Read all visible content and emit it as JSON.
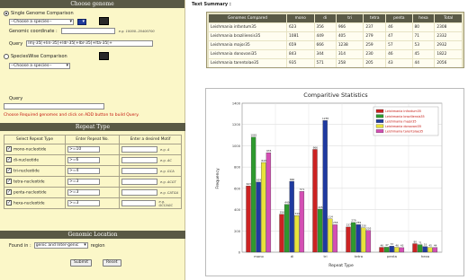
{
  "left": {
    "choose_genome": {
      "header": "Choose genome",
      "single_label": "Single Genome Comparison",
      "species_placeholder": "--Choose a species--",
      "coordinate_label": "Genomic coordinate :",
      "coordinate_hint": "e.g. 10000..20400700",
      "query_label": "Query",
      "query_value": "lmj-35[+lin-35[+ldr-35[+lbr-35[+lta-35[+",
      "specieswise_label": "SpeciesWise Comparison",
      "specieswise_placeholder": "--Choose a species--",
      "query2_label": "Query",
      "notice": "Choose Required genomes and click on ADD button to build Query."
    },
    "repeat_type": {
      "header": "Repeat Type",
      "columns": [
        "Select Repeat Type",
        "Enter Repeat No.",
        "Enter a desired Motif"
      ],
      "rows": [
        {
          "name": "mono-nucleotide",
          "number": ">=10",
          "hint": "e.g. A"
        },
        {
          "name": "di-nucleotide",
          "number": ">=6",
          "hint": "e.g. AC"
        },
        {
          "name": "tri-nucleotide",
          "number": ">=4",
          "hint": "e.g. GCA"
        },
        {
          "name": "tetra-nucleotide",
          "number": ">=3",
          "hint": "e.g. ACGT"
        },
        {
          "name": "penta-nucleotide",
          "number": ">=3",
          "hint": "e.g. CATGA"
        },
        {
          "name": "hexa-nucleotide",
          "number": ">=3",
          "hint": "e.g. GCCAGC"
        }
      ]
    },
    "genomic_location": {
      "header": "Genomic Location",
      "found_in_label": "Found in :",
      "found_in_value": "genic and Inter-genic",
      "region_label": "region",
      "submit": "Submit",
      "reset": "Reset"
    }
  },
  "summary": {
    "title": "Text Summary :",
    "columns": [
      "Genomes Compared",
      "mono",
      "di",
      "tri",
      "tetra",
      "penta",
      "hexa",
      "Total"
    ],
    "rows": [
      [
        "Leishmania infantum35",
        "623",
        "356",
        "966",
        "237",
        "46",
        "80",
        "2308"
      ],
      [
        "Leishmania braziliensis35",
        "1081",
        "449",
        "405",
        "279",
        "47",
        "71",
        "2332"
      ],
      [
        "Leishmania major35",
        "659",
        "666",
        "1238",
        "259",
        "57",
        "53",
        "2932"
      ],
      [
        "Leishmania donovani35",
        "843",
        "344",
        "314",
        "230",
        "46",
        "45",
        "1822"
      ],
      [
        "Leishmania tarentolae35",
        "935",
        "571",
        "258",
        "205",
        "43",
        "44",
        "2056"
      ]
    ]
  },
  "chart_data": {
    "type": "bar",
    "title": "Comparitive Statistics",
    "xlabel": "Repeat Type",
    "ylabel": "Frequency",
    "categories": [
      "mono",
      "di",
      "tri",
      "tetra",
      "penta",
      "hexa"
    ],
    "ylim": [
      0,
      1400
    ],
    "grid": true,
    "legend": "top-right",
    "series": [
      {
        "name": "Leishmania infantum35",
        "color": "#cc2222",
        "values": [
          623,
          356,
          966,
          237,
          46,
          80
        ]
      },
      {
        "name": "Leishmania braziliensis35",
        "color": "#2e9a2e",
        "values": [
          1081,
          449,
          405,
          279,
          47,
          71
        ]
      },
      {
        "name": "Leishmania major35",
        "color": "#1f3aa0",
        "values": [
          659,
          666,
          1238,
          259,
          57,
          53
        ]
      },
      {
        "name": "Leishmania donovani35",
        "color": "#e8e23a",
        "values": [
          843,
          344,
          314,
          230,
          46,
          45
        ]
      },
      {
        "name": "Leishmania tarentolae35",
        "color": "#d44fb4",
        "values": [
          935,
          571,
          258,
          205,
          43,
          44
        ]
      }
    ]
  }
}
